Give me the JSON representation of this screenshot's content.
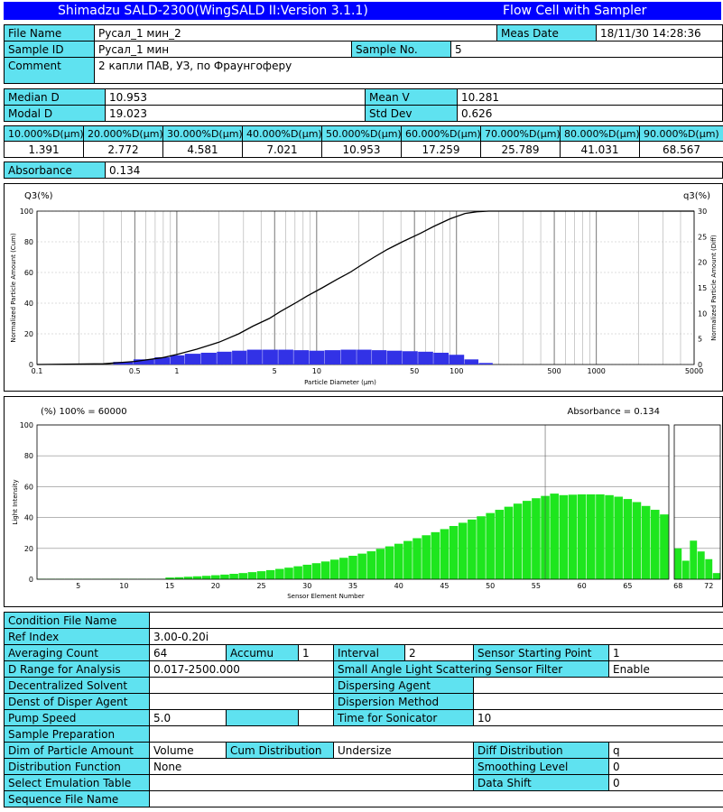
{
  "header": {
    "title": "Shimadzu SALD-2300(WingSALD II:Version 3.1.1)",
    "mode": "Flow Cell with Sampler"
  },
  "info": {
    "file_name_label": "File Name",
    "file_name": "Русал_1 мин_2",
    "meas_date_label": "Meas Date",
    "meas_date": "18/11/30 14:28:36",
    "sample_id_label": "Sample ID",
    "sample_id": "Русал_1 мин",
    "sample_no_label": "Sample No.",
    "sample_no": "5",
    "comment_label": "Comment",
    "comment": "2 капли ПАВ, УЗ, по Фраунгоферу"
  },
  "stats": {
    "median_label": "Median D",
    "median": "10.953",
    "mean_label": "Mean V",
    "mean": "10.281",
    "modal_label": "Modal D",
    "modal": "19.023",
    "std_label": "Std Dev",
    "std": "0.626"
  },
  "percentiles": {
    "headers": [
      "10.000%D(µm)",
      "20.000%D(µm)",
      "30.000%D(µm)",
      "40.000%D(µm)",
      "50.000%D(µm)",
      "60.000%D(µm)",
      "70.000%D(µm)",
      "80.000%D(µm)",
      "90.000%D(µm)"
    ],
    "values": [
      "1.391",
      "2.772",
      "4.581",
      "7.021",
      "10.953",
      "17.259",
      "25.789",
      "41.031",
      "68.567"
    ]
  },
  "absorbance": {
    "label": "Absorbance",
    "value": "0.134"
  },
  "chart_data": [
    {
      "type": "line",
      "left_axis_title": "Q3(%)",
      "right_axis_title": "q3(%)",
      "ylabel": "Normalized Particle Amount (Cum)",
      "y2label": "Normalized Particle Amount (Diff)",
      "xlabel": "Particle Diameter (µm)",
      "x_scale": "log",
      "xlim": [
        0.1,
        5000
      ],
      "ylim": [
        0,
        100
      ],
      "y2lim": [
        0,
        30
      ],
      "x_ticks": [
        "0.1",
        "0.5",
        "1",
        "5",
        "10",
        "50",
        "100",
        "500",
        "1000",
        "5000"
      ],
      "x_tick_values": [
        0.1,
        0.5,
        1,
        5,
        10,
        50,
        100,
        500,
        1000,
        5000
      ],
      "y_ticks": [
        "0",
        "20",
        "40",
        "60",
        "80",
        "100"
      ],
      "y2_ticks": [
        "0",
        "5",
        "10",
        "15",
        "20",
        "25",
        "30"
      ],
      "grid": true,
      "series": [
        {
          "kind": "cumulative",
          "x": [
            0.1,
            0.3,
            0.5,
            0.8,
            1.0,
            1.391,
            2.0,
            2.772,
            3.5,
            4.581,
            5.5,
            7.021,
            8.5,
            10.953,
            14,
            17.259,
            21,
            25.789,
            32,
            41.031,
            55,
            68.567,
            90,
            115,
            140,
            170
          ],
          "y": [
            0,
            0.5,
            2,
            4.5,
            6.5,
            10,
            14.5,
            20,
            25,
            30,
            34.5,
            40,
            44.5,
            50,
            55.5,
            60,
            65,
            70,
            75,
            80,
            85.5,
            90,
            95,
            98.5,
            99.6,
            100
          ]
        },
        {
          "kind": "differential",
          "x": [
            0.4,
            0.6,
            0.8,
            1.0,
            1.3,
            1.7,
            2.2,
            2.8,
            3.6,
            4.7,
            6.0,
            7.8,
            10,
            13,
            17,
            22,
            28,
            36,
            47,
            60,
            78,
            100,
            130,
            160
          ],
          "y": [
            0.5,
            1.0,
            1.4,
            1.8,
            2.1,
            2.3,
            2.5,
            2.7,
            2.9,
            2.9,
            2.9,
            2.8,
            2.7,
            2.8,
            2.9,
            2.9,
            2.8,
            2.7,
            2.6,
            2.5,
            2.3,
            1.9,
            1.0,
            0.3
          ]
        }
      ]
    },
    {
      "type": "bar",
      "left_caption": "(%) 100% = 60000",
      "right_caption": "Absorbance = 0.134",
      "ylabel": "Light Intensity",
      "xlabel": "Sensor Element Number",
      "ylim": [
        0,
        100
      ],
      "y_ticks": [
        "0",
        "20",
        "40",
        "60",
        "80",
        "100"
      ],
      "x_ticks": [
        "5",
        "10",
        "15",
        "20",
        "25",
        "30",
        "35",
        "40",
        "45",
        "50",
        "55",
        "60",
        "65"
      ],
      "x_tick_values": [
        5,
        10,
        15,
        20,
        25,
        30,
        35,
        40,
        45,
        50,
        55,
        60,
        65
      ],
      "x2_ticks": [
        "68",
        "72"
      ],
      "x2_tick_values": [
        68,
        72
      ],
      "grid": true,
      "values": [
        0.3,
        0.3,
        0.3,
        0.3,
        0.3,
        0.3,
        0.3,
        0.3,
        0.3,
        0.3,
        0.3,
        0.3,
        0.3,
        0.3,
        1.1,
        1.3,
        1.6,
        1.9,
        2.2,
        2.6,
        3.0,
        3.5,
        4.0,
        4.6,
        5.2,
        5.9,
        6.7,
        7.5,
        8.4,
        9.4,
        10.4,
        11.5,
        12.7,
        13.9,
        15.2,
        16.6,
        18.1,
        19.7,
        21.3,
        23.0,
        24.8,
        26.6,
        28.5,
        30.5,
        32.5,
        34.5,
        36.6,
        38.7,
        40.8,
        42.9,
        45.0,
        47.0,
        49.0,
        50.8,
        52.5,
        54.0,
        55.5,
        54.5,
        54.8,
        55.0,
        55.0,
        55.0,
        54.5,
        53.5,
        52.0,
        50.0,
        47.5,
        45.0,
        42.0
      ],
      "values2": [
        20,
        12,
        25,
        18,
        13,
        4
      ]
    }
  ],
  "conditions": {
    "condition_file_label": "Condition File Name",
    "condition_file": "",
    "ref_index_label": "Ref Index",
    "ref_index": "3.00-0.20i",
    "avg_label": "Averaging Count",
    "avg": "64",
    "accumu_label": "Accumu",
    "accumu": "1",
    "interval_label": "Interval",
    "interval": "2",
    "ssp_label": "Sensor Starting Point",
    "ssp": "1",
    "drange_label": "D Range for Analysis",
    "drange": "0.017-2500.000",
    "salss_label": "Small Angle Light Scattering Sensor Filter",
    "salss": "Enable",
    "decent_label": "Decentralized Solvent",
    "decent": "",
    "disp_agent_label": "Dispersing Agent",
    "disp_agent": "",
    "denst_label": "Denst of Disper Agent",
    "denst": "",
    "disp_method_label": "Dispersion Method",
    "disp_method": "",
    "pump_label": "Pump Speed",
    "pump": "5.0",
    "sonic_label": "Time for Sonicator",
    "sonic": "10",
    "sample_prep_label": "Sample Preparation",
    "dim_label": "Dim of Particle Amount",
    "dim": "Volume",
    "cum_label": "Cum Distribution",
    "cum": "Undersize",
    "diff_label": "Diff Distribution",
    "diff": "q",
    "distfunc_label": "Distribution Function",
    "distfunc": "None",
    "smooth_label": "Smoothing Level",
    "smooth": "0",
    "emul_label": "Select Emulation Table",
    "emul": "",
    "shift_label": "Data Shift",
    "shift": "0",
    "seq_label": "Sequence File Name",
    "seq": ""
  },
  "colors": {
    "label_bg": "#5fe2f0",
    "title_bg": "#0000ff",
    "diff_bar": "#3232e6",
    "intensity_bar": "#1ee61e"
  }
}
